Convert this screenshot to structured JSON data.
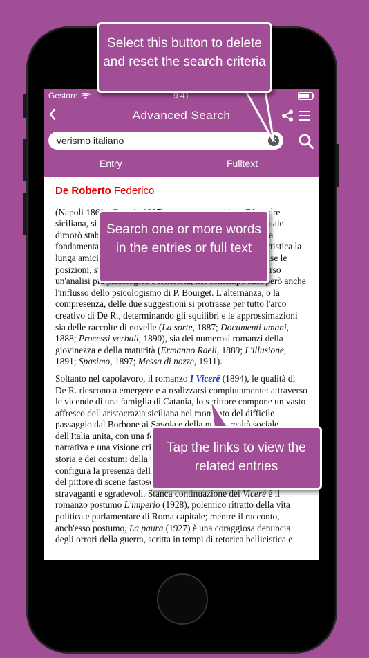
{
  "status_bar": {
    "carrier": "Gestore",
    "time": "9:41"
  },
  "navbar": {
    "back_icon": "chevron-left-icon",
    "title": "Advanced Search",
    "share_icon": "share-icon",
    "menu_icon": "hamburger-menu-icon"
  },
  "search": {
    "value": "verismo italiano",
    "clear_icon": "clear-x-icon",
    "search_icon": "magnifier-icon"
  },
  "tabs": [
    {
      "label": "Entry",
      "active": false
    },
    {
      "label": "Fulltext",
      "active": true
    }
  ],
  "entry": {
    "surname": "De Roberto",
    "name": "Federico",
    "p1": "(Napoli 1861 - Catania 1927), narratore e saggista. Di madre siciliana, si trasferì ancora ragazzo a Catania, città nella quale dimorò stabilmente per il resto della vita. Fu di importanza fondamentale per la sua formazione e la sua evoluzione artistica la lunga amicizia di G. Verga e di L. Capuana, di cui condivise le posizioni, superandone i postulati teorici e spingendosi verso un'analisi più psicologica e letteraria; nel contempo subì però anche l'influsso dello psicologismo di P. Bourget. L'alternanza, o la compresenza, delle due suggestioni si protrasse per tutto l'arco creativo di De R., determinando gli squilibri e le approssimazioni sia delle raccolte di novelle (",
    "p1_i1": "La sorte",
    "p1_t2": ", 1887; ",
    "p1_i2": "Documenti umani",
    "p1_t3": ", 1888; ",
    "p1_i3": "Processi verbali",
    "p1_t4": ", 1890), sia dei numerosi romanzi della giovinezza e della maturità (",
    "p1_i4": "Ermanno Raeli",
    "p1_t5": ", 1889; ",
    "p1_i5": "L'illusione",
    "p1_t6": ", 1891; ",
    "p1_i6": "Spasimo",
    "p1_t7": ", 1897; ",
    "p1_i7": "Messa di nozze",
    "p1_t8": ", 1911).",
    "p2_a": "Soltanto nel capolavoro, il romanzo ",
    "p2_link": "I Viceré",
    "p2_b": " (1894), le qualità di De R. riescono a emergere e a realizzarsi compiutamente: attraverso le vicende di una famiglia di Catania, lo scrittore compone un vasto affresco dell'aristocrazia siciliana nel momento del difficile passaggio dal Borbone ai Savoia e della nuova realtà sociale dell'Italia unita, con una fedeltà alla lezione veristica una capacità narrativa e una visione critica molto vigorosa, nel tessuto vivo della storia e dei costumi della vita nazionale. In questa prospettiva si configura la presenza dell'osservatore spietato, dello storico realista, del pittore di scene fastose e lucide, del creatore di personaggi stravaganti e sgradevoli. Stanca continuazione dei ",
    "p2_i1": "Viceré",
    "p2_c": " è il romanzo postumo ",
    "p2_i2": "L'imperio",
    "p2_d": " (1928), polemico ritratto della vita politica e parlamentare di Roma capitale; mentre il racconto, anch'esso postumo, ",
    "p2_i3": "La paura",
    "p2_e": " (1927) è una coraggiosa denuncia degli orrori della guerra, scritta in tempi di retorica bellicistica e"
  },
  "callouts": {
    "c1": "Select this button to delete and reset the search criteria",
    "c2": "Search one or more words in the entries or full text",
    "c3": "Tap the links to view the related entries"
  },
  "colors": {
    "accent": "#a24e96",
    "entry_head": "#e00000",
    "link": "#1a33cc"
  }
}
